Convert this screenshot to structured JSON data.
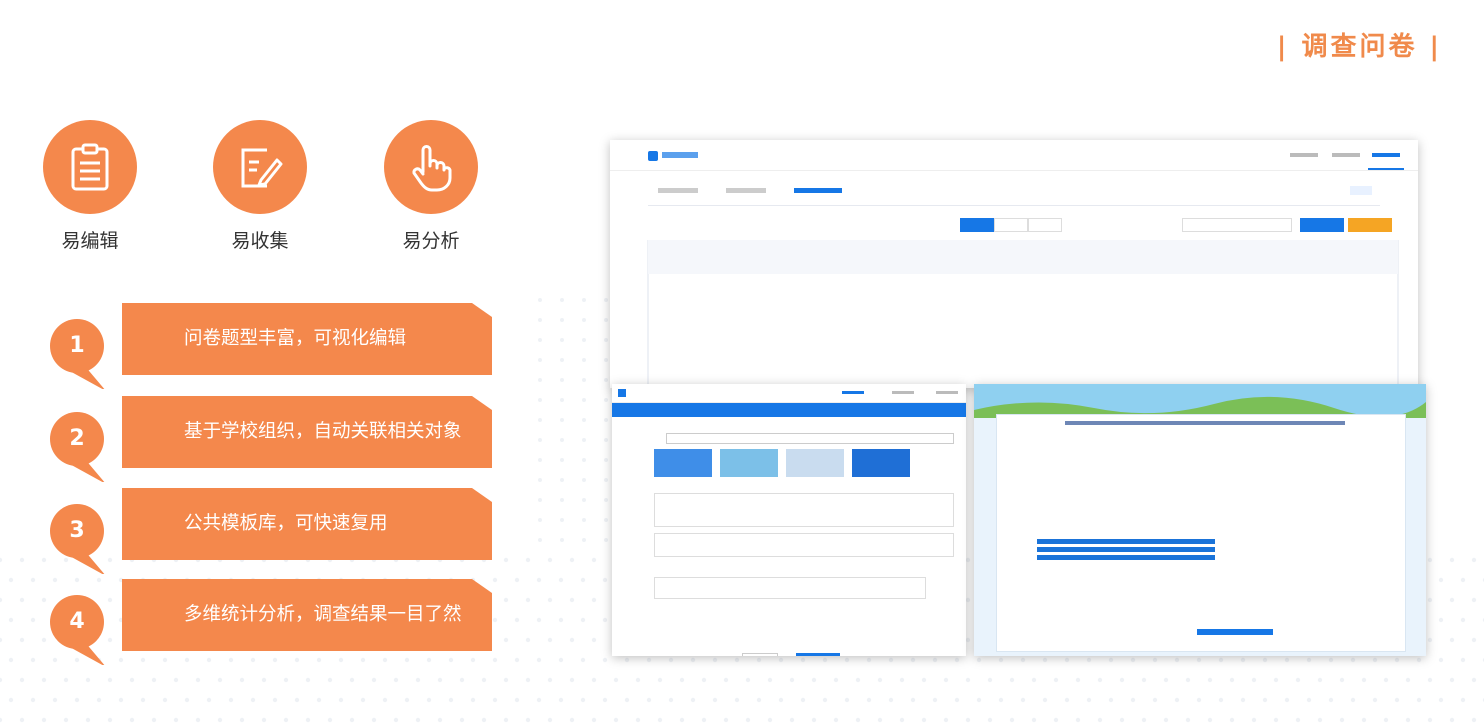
{
  "page_title": "| 调查问卷 |",
  "features": [
    {
      "icon": "clipboard-icon",
      "label": "易编辑"
    },
    {
      "icon": "edit-pen-icon",
      "label": "易收集"
    },
    {
      "icon": "pointer-hand-icon",
      "label": "易分析"
    }
  ],
  "points": [
    {
      "num": "1",
      "text": "问卷题型丰富，可视化编辑"
    },
    {
      "num": "2",
      "text": "基于学校组织，自动关联相关对象"
    },
    {
      "num": "3",
      "text": "公共模板库，可快速复用"
    },
    {
      "num": "4",
      "text": "多维统计分析，调查结果一目了然"
    }
  ],
  "colors": {
    "accent": "#f4884c",
    "title": "#f08a4b",
    "app_blue": "#1677e6",
    "app_orange": "#f5a524"
  }
}
